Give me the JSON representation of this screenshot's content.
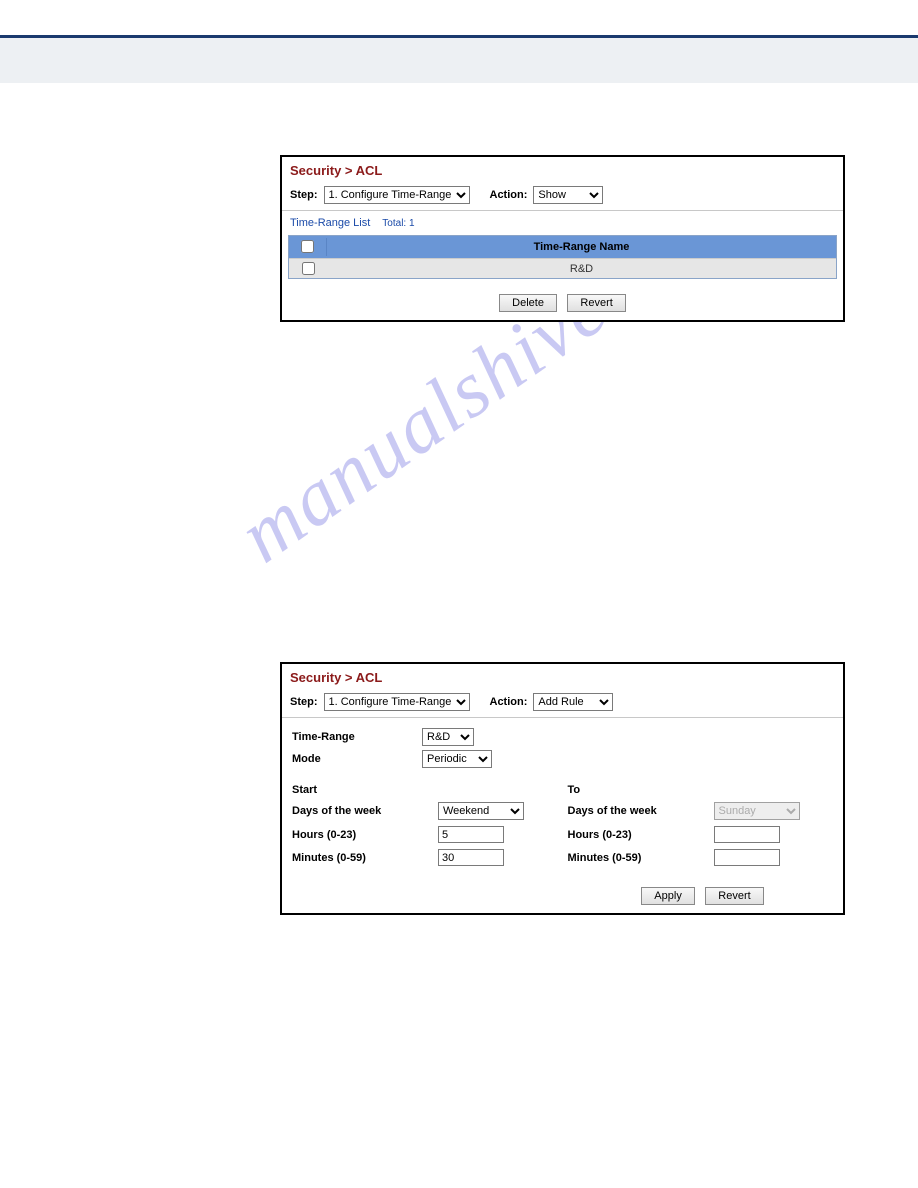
{
  "watermark": "manualshive.com",
  "panel1": {
    "breadcrumb": "Security > ACL",
    "step_label": "Step:",
    "step_value": "1. Configure Time-Range",
    "action_label": "Action:",
    "action_value": "Show",
    "list_title": "Time-Range List",
    "list_total": "Total: 1",
    "col_name": "Time-Range Name",
    "rows": [
      {
        "name": "R&D"
      }
    ],
    "btn_delete": "Delete",
    "btn_revert": "Revert"
  },
  "panel2": {
    "breadcrumb": "Security > ACL",
    "step_label": "Step:",
    "step_value": "1. Configure Time-Range",
    "action_label": "Action:",
    "action_value": "Add Rule",
    "time_range_label": "Time-Range",
    "time_range_value": "R&D",
    "mode_label": "Mode",
    "mode_value": "Periodic",
    "start_header": "Start",
    "to_header": "To",
    "dow_label": "Days of the week",
    "hours_label": "Hours (0-23)",
    "minutes_label": "Minutes (0-59)",
    "start_dow": "Weekend",
    "start_hours": "5",
    "start_minutes": "30",
    "to_dow": "Sunday",
    "to_hours": "",
    "to_minutes": "",
    "btn_apply": "Apply",
    "btn_revert": "Revert"
  }
}
